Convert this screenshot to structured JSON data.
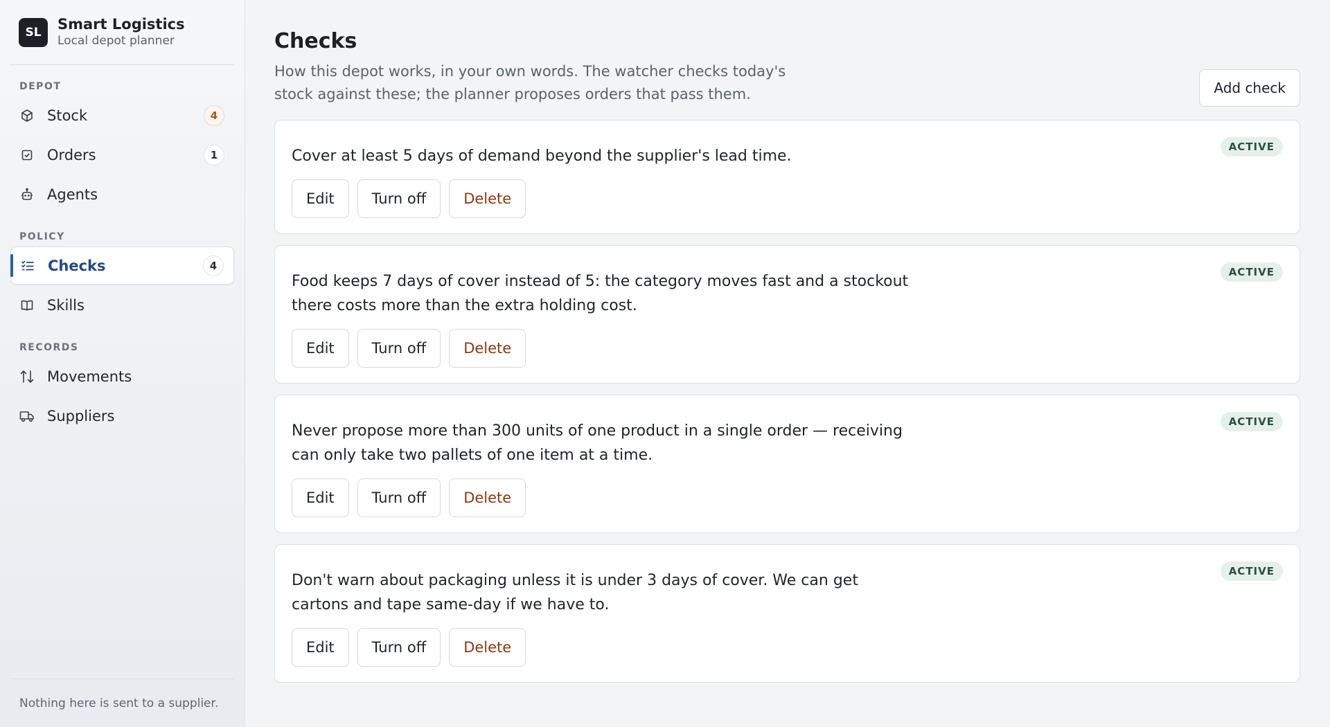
{
  "brand": {
    "initials": "SL",
    "name": "Smart Logistics",
    "subtitle": "Local depot planner"
  },
  "sidebar": {
    "sections": [
      {
        "title": "DEPOT"
      },
      {
        "title": "POLICY"
      },
      {
        "title": "RECORDS"
      }
    ],
    "items": [
      {
        "label": "Stock",
        "icon": "box-icon",
        "badge": "4"
      },
      {
        "label": "Orders",
        "icon": "checkbox-icon",
        "badge": "1"
      },
      {
        "label": "Agents",
        "icon": "robot-icon"
      },
      {
        "label": "Checks",
        "icon": "checklist-icon",
        "badge": "4",
        "active": true
      },
      {
        "label": "Skills",
        "icon": "book-icon"
      },
      {
        "label": "Movements",
        "icon": "arrows-updown-icon"
      },
      {
        "label": "Suppliers",
        "icon": "truck-icon"
      }
    ],
    "footer": "Nothing here is sent to a supplier."
  },
  "main": {
    "title": "Checks",
    "description": "How this depot works, in your own words. The watcher checks today's stock against these; the planner proposes orders that pass them.",
    "add_label": "Add check",
    "checks": [
      {
        "text": "Cover at least 5 days of demand beyond the supplier's lead time.",
        "status": "ACTIVE",
        "edit": "Edit",
        "toggle": "Turn off",
        "delete": "Delete"
      },
      {
        "text": "Food keeps 7 days of cover instead of 5: the category moves fast and a stockout there costs more than the extra holding cost.",
        "status": "ACTIVE",
        "edit": "Edit",
        "toggle": "Turn off",
        "delete": "Delete"
      },
      {
        "text": "Never propose more than 300 units of one product in a single order — receiving can only take two pallets of one item at a time.",
        "status": "ACTIVE",
        "edit": "Edit",
        "toggle": "Turn off",
        "delete": "Delete"
      },
      {
        "text": "Don't warn about packaging unless it is under 3 days of cover. We can get cartons and tape same-day if we have to.",
        "status": "ACTIVE",
        "edit": "Edit",
        "toggle": "Turn off",
        "delete": "Delete"
      }
    ]
  },
  "colors": {
    "accent": "#2d5ea5",
    "status_bg": "#e6f0ea",
    "danger": "#8a3a12"
  }
}
